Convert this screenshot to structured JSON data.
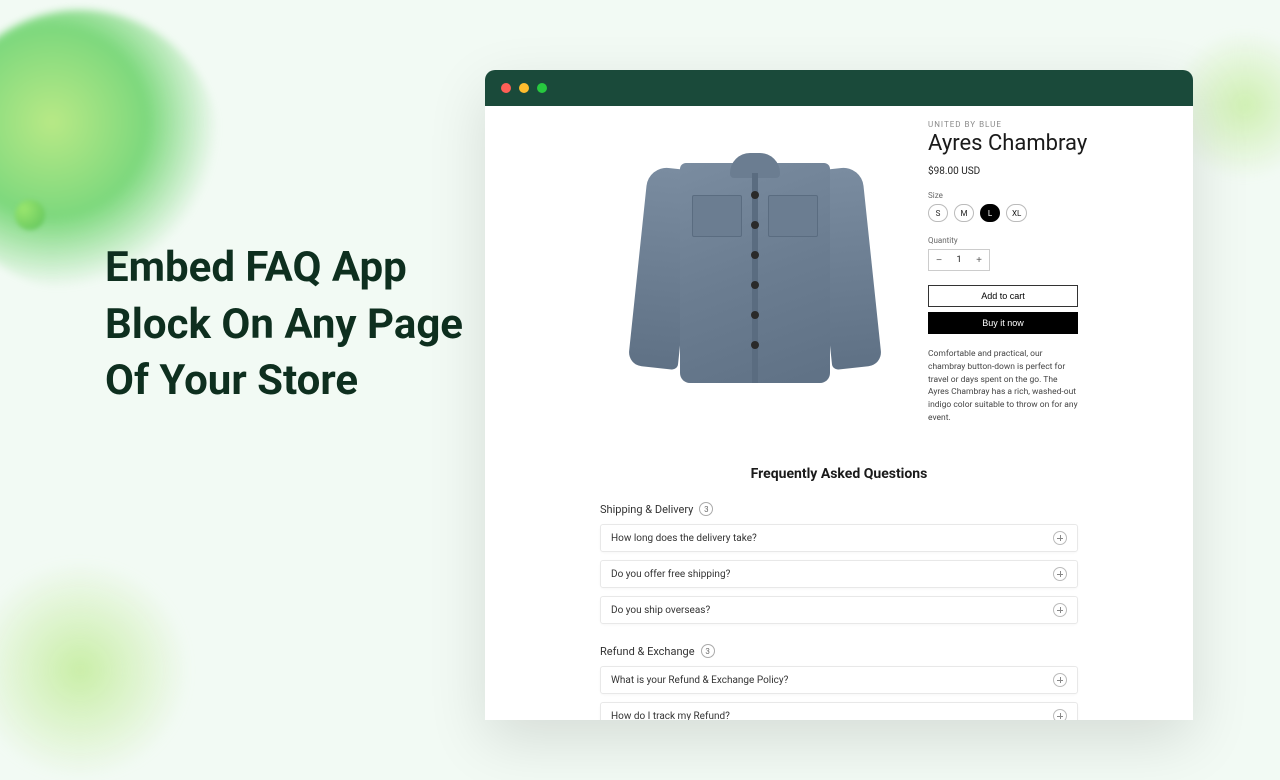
{
  "headline": "Embed FAQ App Block On Any Page Of Your Store",
  "product": {
    "brand": "UNITED BY BLUE",
    "title": "Ayres Chambray",
    "price": "$98.00 USD",
    "size_label": "Size",
    "sizes": [
      "S",
      "M",
      "L",
      "XL"
    ],
    "selected_size": "L",
    "qty_label": "Quantity",
    "qty": "1",
    "add_to_cart": "Add to cart",
    "buy_now": "Buy it now",
    "description": "Comfortable and practical, our chambray button-down is perfect for travel or days spent on the go. The Ayres Chambray has a rich, washed-out indigo color suitable to throw on for any event."
  },
  "faq": {
    "heading": "Frequently Asked Questions",
    "categories": [
      {
        "name": "Shipping & Delivery",
        "count": "3",
        "items": [
          "How long does the delivery take?",
          "Do you offer free shipping?",
          "Do you ship overseas?"
        ]
      },
      {
        "name": "Refund & Exchange",
        "count": "3",
        "items": [
          "What is your Refund & Exchange Policy?",
          "How do I track my Refund?"
        ]
      }
    ]
  }
}
